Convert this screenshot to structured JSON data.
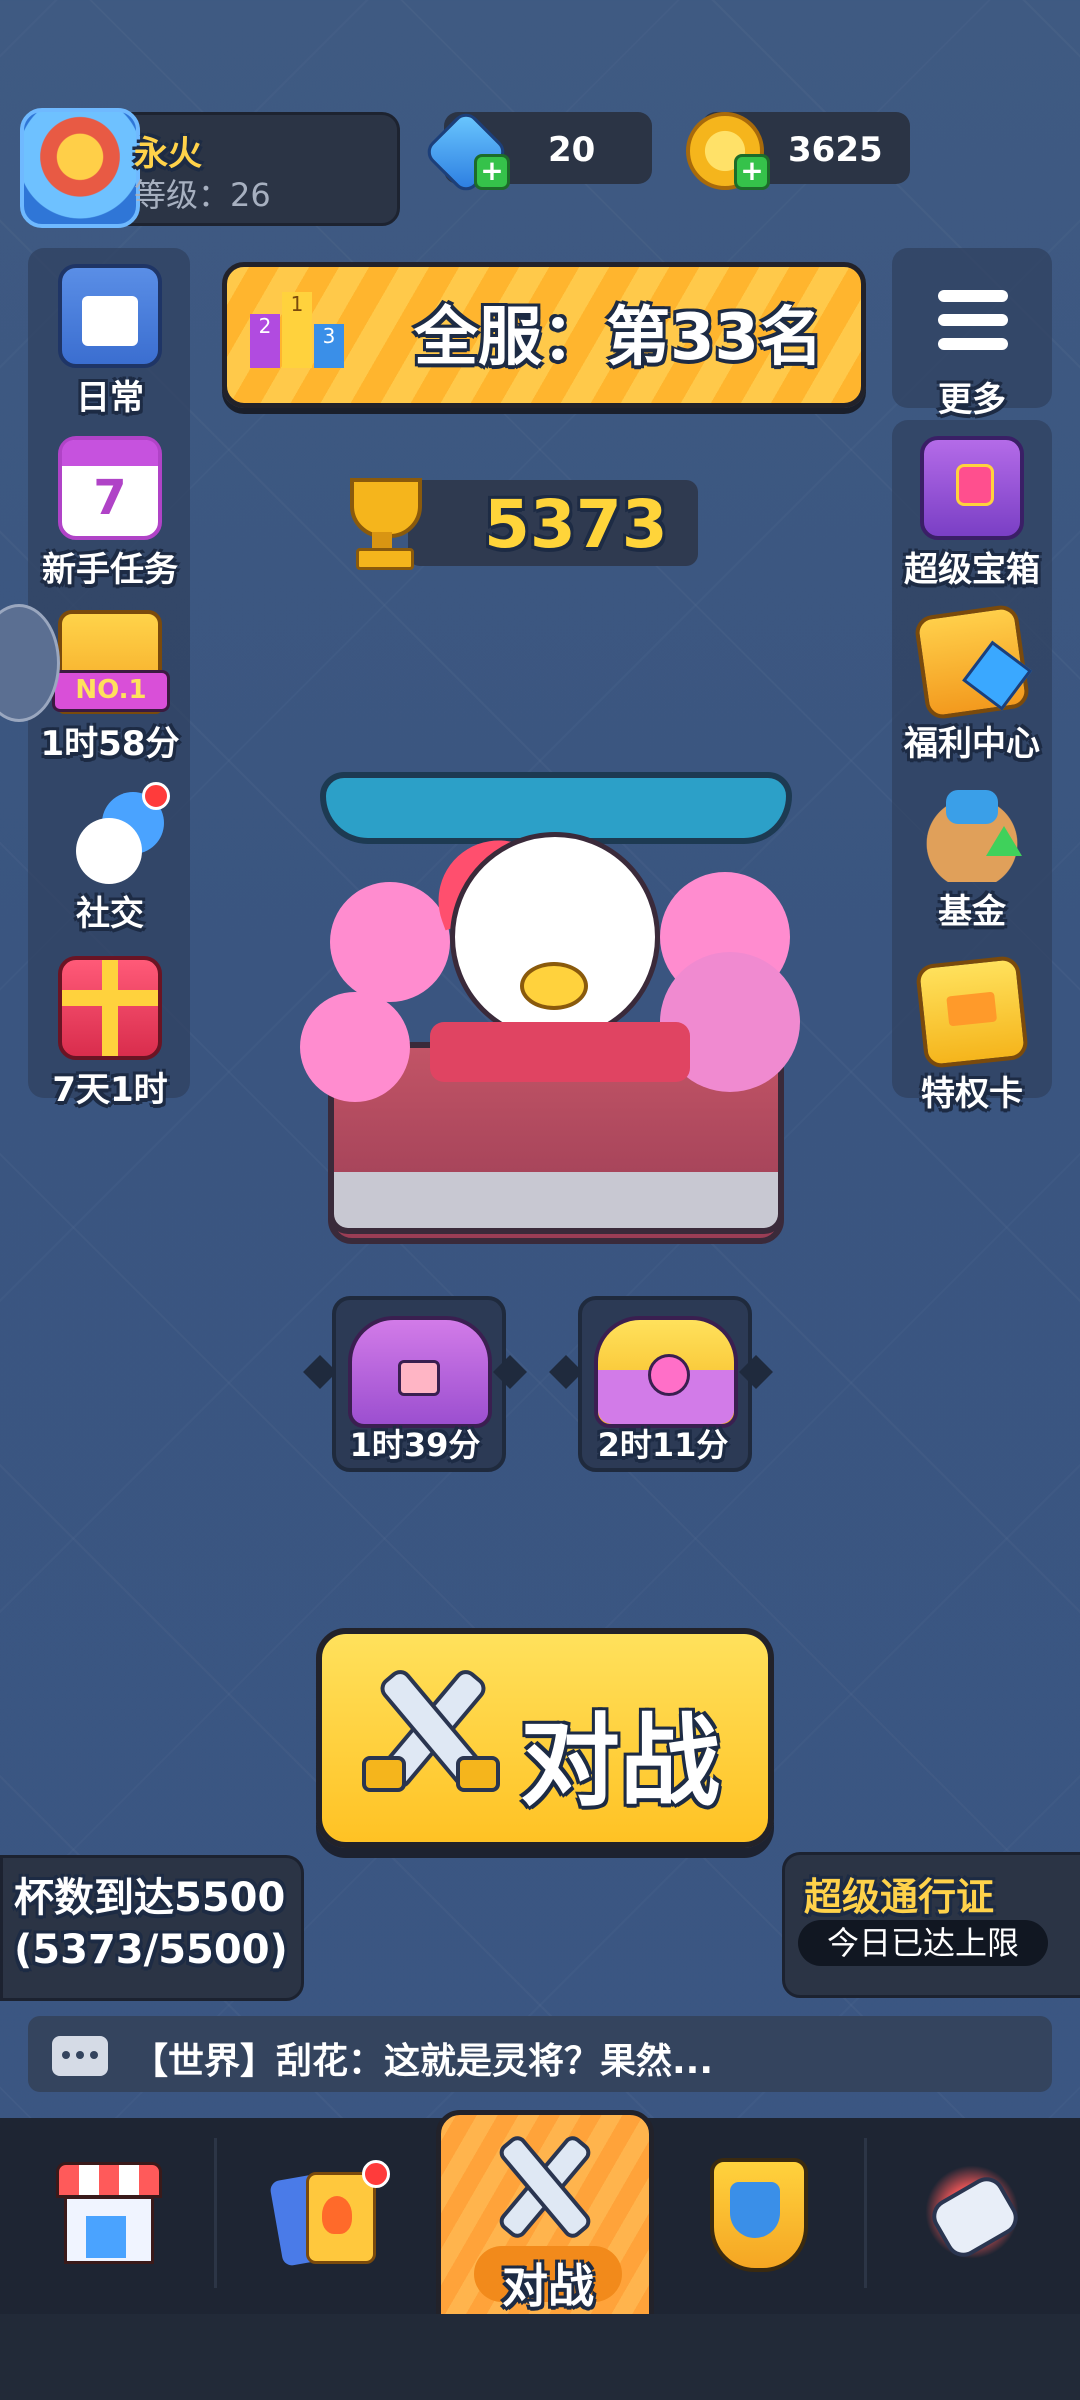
{
  "player": {
    "name": "永火",
    "level_text": "等级：26"
  },
  "currencies": {
    "gems": "20",
    "gold": "3625"
  },
  "left_menu": [
    {
      "label": "日常",
      "icon": "clipboard-icon"
    },
    {
      "label": "新手任务",
      "icon": "calendar-icon",
      "badge": "7"
    },
    {
      "label": "1时58分",
      "icon": "no1-podium-icon",
      "badge": "NO.1"
    },
    {
      "label": "社交",
      "icon": "chat-bubbles-icon"
    },
    {
      "label": "7天1时",
      "icon": "gift-icon"
    }
  ],
  "right_menu": [
    {
      "label": "更多",
      "icon": "list-icon"
    },
    {
      "label": "超级宝箱",
      "icon": "super-chest-icon"
    },
    {
      "label": "福利中心",
      "icon": "welfare-icon"
    },
    {
      "label": "基金",
      "icon": "fund-bag-icon"
    },
    {
      "label": "特权卡",
      "icon": "privilege-card-icon"
    }
  ],
  "rank_banner": {
    "text": "全服：第33名",
    "podium": [
      "2",
      "1",
      "3"
    ]
  },
  "trophies": "5373",
  "chests": [
    {
      "time": "1时39分",
      "color": "#c96be0"
    },
    {
      "time": "2时11分",
      "color": "#ffd23d"
    }
  ],
  "battle_button": "对战",
  "quest": {
    "line1": "杯数到达5500",
    "line2": "(5373/5500)"
  },
  "pass": {
    "title": "超级通行证",
    "status": "今日已达上限"
  },
  "chat": {
    "message": "【世界】刮花：这就是灵将？果然..."
  },
  "bottom_nav": [
    {
      "icon": "shop-icon"
    },
    {
      "icon": "cards-icon"
    },
    {
      "icon": "battle-swords-icon",
      "label": "对战"
    },
    {
      "icon": "clan-shield-icon"
    },
    {
      "icon": "power-fist-icon"
    }
  ],
  "colors": {
    "accent_yellow": "#ffd24a",
    "panel": "#2b3445",
    "background": "#3f5a82"
  }
}
